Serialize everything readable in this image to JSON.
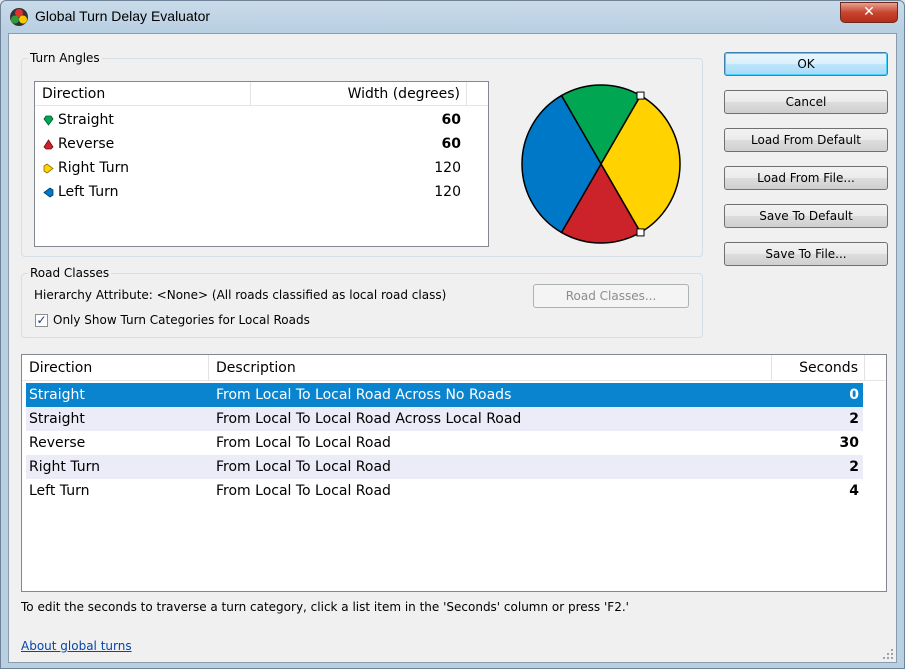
{
  "window": {
    "title": "Global Turn Delay Evaluator",
    "close_glyph": "✕"
  },
  "turn_angles": {
    "group_label": "Turn Angles",
    "headers": {
      "direction": "Direction",
      "width": "Width (degrees)"
    },
    "rows": [
      {
        "direction": "Straight",
        "width": "60",
        "bold": true,
        "color": "#00a651"
      },
      {
        "direction": "Reverse",
        "width": "60",
        "bold": true,
        "color": "#cc2229"
      },
      {
        "direction": "Right Turn",
        "width": "120",
        "bold": false,
        "color": "#ffd200"
      },
      {
        "direction": "Left Turn",
        "width": "120",
        "bold": false,
        "color": "#0078c8"
      }
    ]
  },
  "pie": {
    "slices": [
      {
        "name": "Straight",
        "degrees": 60,
        "color": "#00a651"
      },
      {
        "name": "Right Turn",
        "degrees": 120,
        "color": "#ffd200"
      },
      {
        "name": "Reverse",
        "degrees": 60,
        "color": "#cc2229"
      },
      {
        "name": "Left Turn",
        "degrees": 120,
        "color": "#0078c8"
      }
    ]
  },
  "road_classes": {
    "group_label": "Road Classes",
    "hierarchy_text": "Hierarchy Attribute: <None> (All roads classified as local road class)",
    "road_classes_button": "Road Classes...",
    "checkbox_label": "Only Show Turn Categories for Local Roads",
    "checkbox_checked": true,
    "check_glyph": "✓"
  },
  "buttons": {
    "ok": "OK",
    "cancel": "Cancel",
    "load_default": "Load From Default",
    "load_file": "Load From File...",
    "save_default": "Save To Default",
    "save_file": "Save To File..."
  },
  "turn_list": {
    "headers": {
      "direction": "Direction",
      "description": "Description",
      "seconds": "Seconds"
    },
    "rows": [
      {
        "direction": "Straight",
        "description": "From Local To Local Road Across No Roads",
        "seconds": "0",
        "selected": true
      },
      {
        "direction": "Straight",
        "description": "From Local To Local Road Across Local Road",
        "seconds": "2",
        "selected": false
      },
      {
        "direction": "Reverse",
        "description": "From Local To Local Road",
        "seconds": "30",
        "selected": false
      },
      {
        "direction": "Right Turn",
        "description": "From Local To Local Road",
        "seconds": "2",
        "selected": false
      },
      {
        "direction": "Left Turn",
        "description": "From Local To Local Road",
        "seconds": "4",
        "selected": false
      }
    ]
  },
  "hint_text": "To edit the seconds to traverse a turn category, click a list item in the 'Seconds' column or press 'F2.'",
  "about_link": "About global turns",
  "colors": {
    "selection": "#0a84cf",
    "alt_row": "#ececf8"
  }
}
